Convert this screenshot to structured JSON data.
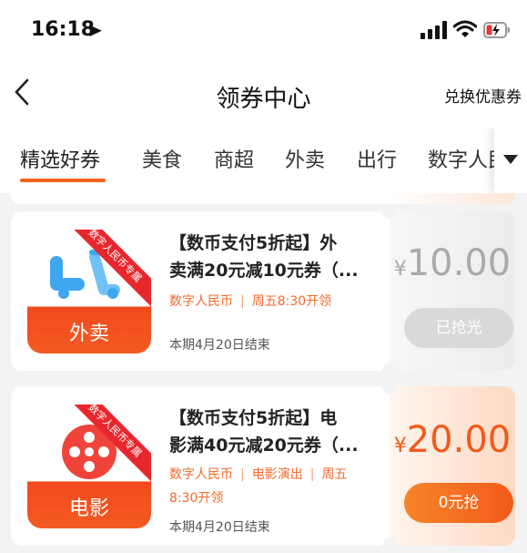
{
  "status": {
    "time": "16:18"
  },
  "nav": {
    "title": "领券中心",
    "exchange": "兑换优惠券"
  },
  "tabs": [
    {
      "label": "精选好券"
    },
    {
      "label": "美食"
    },
    {
      "label": "商超"
    },
    {
      "label": "外卖"
    },
    {
      "label": "出行"
    },
    {
      "label": "数字人民币专区"
    }
  ],
  "coupons": [
    {
      "band": "数字人民币专属",
      "category": "外卖",
      "title_line1": "【数币支付5折起】外",
      "title_line2": "卖满20元减10元券（...",
      "tag1": "数字人民币",
      "sep": "|",
      "tag2": "周五8:30开领",
      "end": "本期4月20日结束",
      "currency": "¥",
      "amount": "10.00",
      "button": "已抢光"
    },
    {
      "band": "数字人民币专属",
      "category": "电影",
      "title_line1": "【数币支付5折起】电",
      "title_line2": "影满40元减20元券（...",
      "tag1": "数字人民币",
      "sep": "|",
      "tag2": "电影演出",
      "tag3": "周五",
      "tag3b": "8:30开领",
      "end": "本期4月20日结束",
      "currency": "¥",
      "amount": "20.00",
      "button": "0元抢"
    }
  ],
  "colors": {
    "accent": "#f25a1a",
    "band": "#e8272d",
    "scooter": "#3fa6f0",
    "reel": "#f0443a"
  }
}
